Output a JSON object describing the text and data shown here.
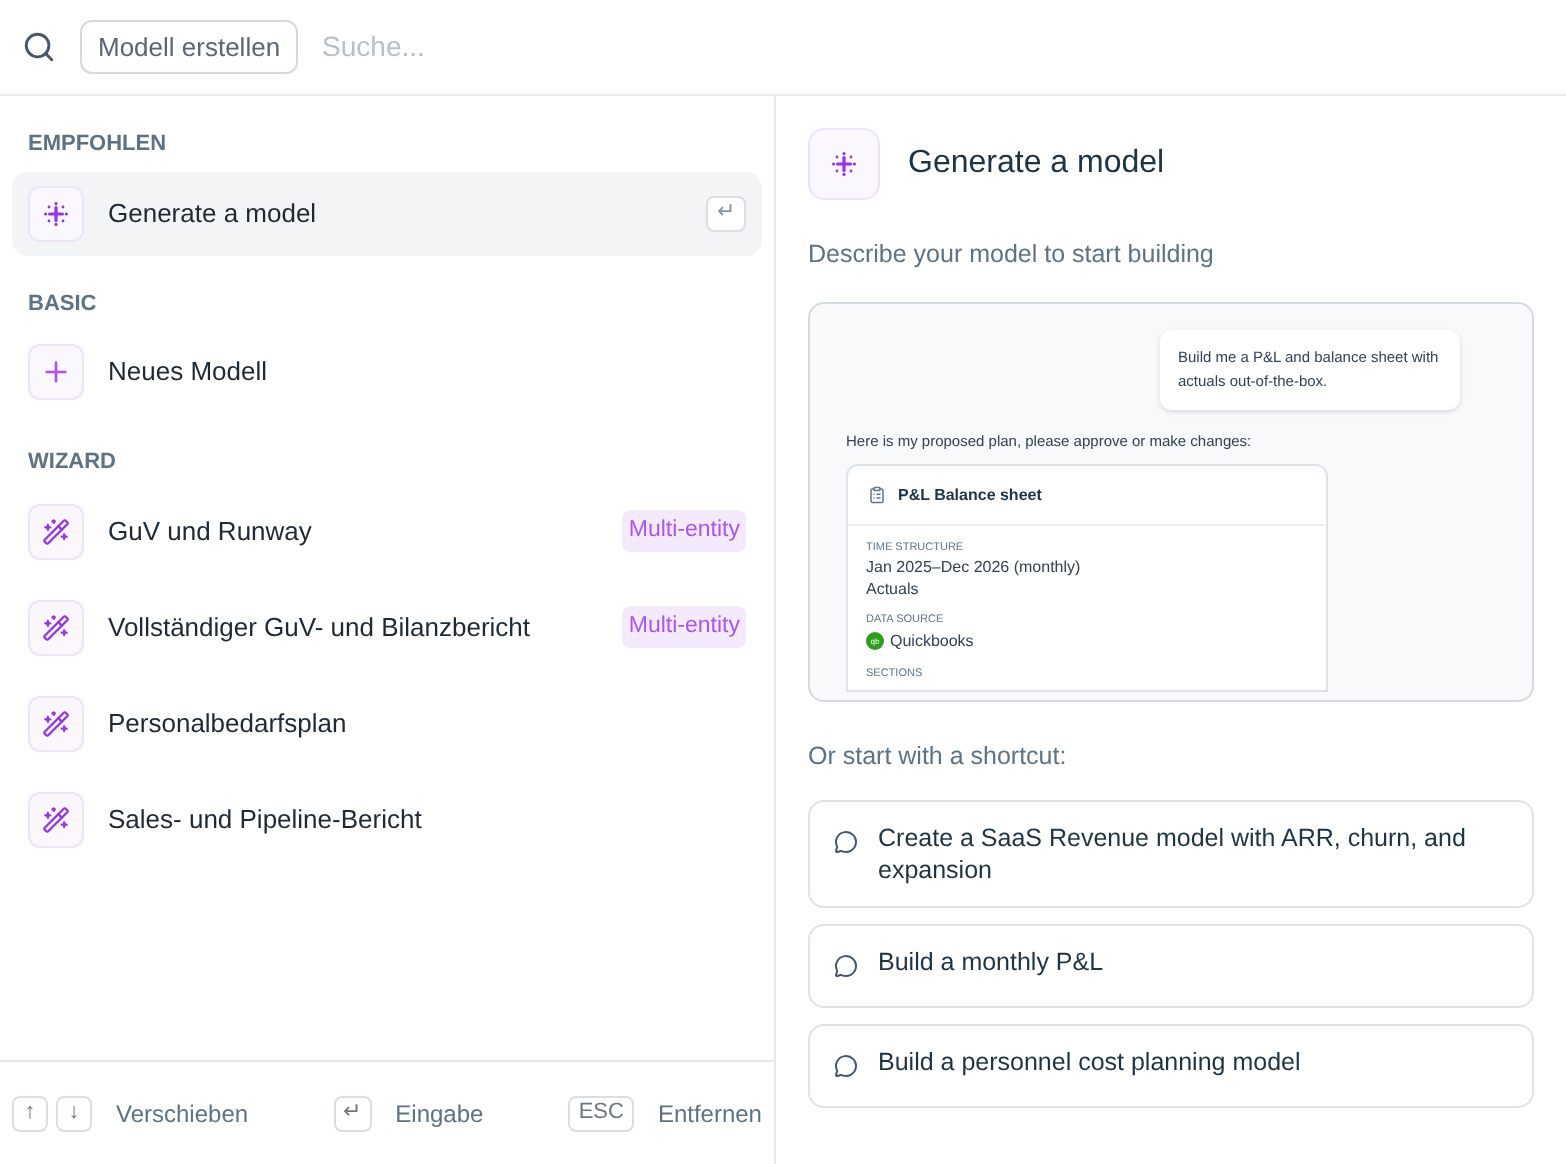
{
  "search": {
    "chip": "Modell erstellen",
    "placeholder": "Suche..."
  },
  "sections": [
    {
      "title": "EMPFOHLEN",
      "items": [
        {
          "kind": "generate",
          "label": "Generate a model",
          "selected": true,
          "hint": "↵"
        }
      ]
    },
    {
      "title": "BASIC",
      "items": [
        {
          "kind": "plus",
          "label": "Neues Modell",
          "selected": false
        }
      ]
    },
    {
      "title": "WIZARD",
      "items": [
        {
          "kind": "wizard",
          "label": "GuV und Runway",
          "selected": false,
          "badge": "Multi-entity"
        },
        {
          "kind": "wizard",
          "label": "Vollständiger GuV- und Bilanzbericht",
          "selected": false,
          "badge": "Multi-entity"
        },
        {
          "kind": "wizard",
          "label": "Personalbedarfsplan",
          "selected": false
        },
        {
          "kind": "wizard",
          "label": "Sales- und Pipeline-Bericht",
          "selected": false
        }
      ]
    }
  ],
  "footer": [
    {
      "keys": [
        "↑",
        "↓"
      ],
      "label": "Verschieben"
    },
    {
      "keys": [
        "↵"
      ],
      "label": "Eingabe"
    },
    {
      "keys": [
        "ESC"
      ],
      "label": "Entfernen"
    }
  ],
  "detail": {
    "title": "Generate a model",
    "subtitle": "Describe your model to start building",
    "preview": {
      "prompt": "Build me a P&L and balance sheet with actuals out-of-the-box.",
      "reply": "Here is my proposed plan, please approve or make changes:",
      "plan_title": "P&L Balance sheet",
      "fields": [
        {
          "label": "TIME STRUCTURE",
          "lines": [
            "Jan 2025–Dec 2026 (monthly)",
            "Actuals"
          ]
        },
        {
          "label": "DATA SOURCE",
          "source": "Quickbooks",
          "source_logo": "qb"
        }
      ],
      "next_label": "SECTIONS"
    },
    "shortcut_heading": "Or start with a shortcut:",
    "shortcuts": [
      "Create a SaaS Revenue model with ARR, churn, and expansion",
      "Build a monthly P&L",
      "Build a personnel cost planning model"
    ]
  }
}
